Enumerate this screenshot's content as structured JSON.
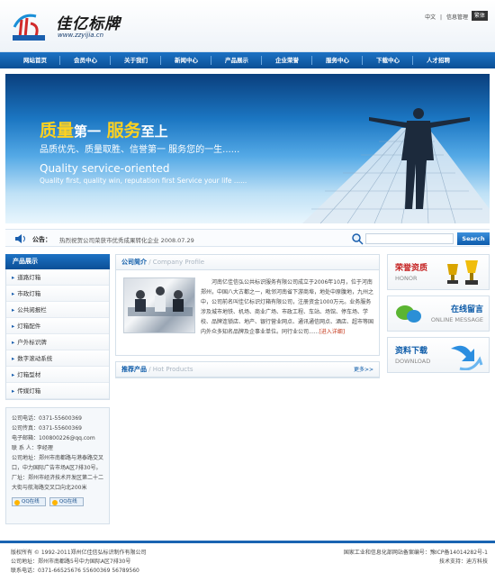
{
  "header": {
    "logo_title": "佳亿标牌",
    "logo_url": "www.zzyijia.cn",
    "top_links": [
      "中文",
      "|",
      "信息管理"
    ],
    "flag_label": "繁体"
  },
  "nav": {
    "items": [
      "网站首页",
      "会员中心",
      "关于我们",
      "新闻中心",
      "产品展示",
      "企业荣誉",
      "服务中心",
      "下载中心",
      "人才招聘"
    ]
  },
  "banner": {
    "title_part1": "质量",
    "title_part2": "第一",
    "title_part3": "服务",
    "title_part4": "至上",
    "slogan": "品质优先、质量取胜、信誉第一 服务您的一生......",
    "en_title": "Quality service-oriented",
    "en_sub": "Quality first, quality win, reputation first Service your life ......"
  },
  "notice": {
    "label": "公告：",
    "text": "热烈祝贺公司荣获市优秀成果转化企业 2008.07.29",
    "search_button": "Search"
  },
  "products_sidebar": {
    "title": "产品展示",
    "items": [
      "道路灯箱",
      "市政灯箱",
      "公共阅报栏",
      "灯箱配件",
      "户外标识牌",
      "数字滚动系统",
      "灯箱型材",
      "传媒灯箱"
    ]
  },
  "contact": {
    "lines": [
      "公司电话：0371-55600369",
      "公司传真：0371-55600369",
      "电子邮箱：100800226@qq.com",
      "联 系 人：李经理",
      "公司地址：郑州市南都路与港泰路交叉口，中力国际广告市场A区7排30号。",
      "厂址：郑州市经济技术开发区第二十二大街与航海路交叉口向北200米"
    ],
    "qq_labels": [
      "QQ在线",
      "QQ在线"
    ]
  },
  "intro": {
    "title_cn": "公司简介",
    "title_en": " / Company Profile",
    "text": "河南亿佳信弘公共标识服务有限公司成立于2006年10月，位于河南郑州，中国八大古都之一，毗邻河南省下游商埠，地处中原腹地，九州之中，公司前名叫佳亿标识灯箱有限公司，注册资金1000万元。业务服务涉及城市地铁、机场、商业广场、市政工程、车站、场馆、停车场、学校、品牌连锁店、地产、银行营业网点、通讯通信网点、酒店、超市等国内外众多知名品牌及企事业单位。同行业公司......",
    "more": "[进入详细]"
  },
  "hot": {
    "title_cn": "推荐产品",
    "title_en": " / Hot Products",
    "more": "更多>>"
  },
  "side": {
    "honor_cn": "荣誉资质",
    "honor_en": "HONOR",
    "msg_cn": "在线留言",
    "msg_en": "ONLINE MESSAGE",
    "dl_cn": "资料下载",
    "dl_en": "DOWNLOAD"
  },
  "footer": {
    "left": [
      "版权所有 © 1992-2011郑州亿佳信弘标识制作有限公司",
      "公司地址：郑州市南都路5号中力国际A区7排30号",
      "联系电话：0371-66525676  55600369  56789560"
    ],
    "right": [
      "国家工业和信息化部网站备案编号：豫ICP备14014282号-1",
      "技术支持：迪方科技"
    ]
  },
  "colors": {
    "nav_blue": "#0b4f96",
    "accent_yellow": "#ffd21f",
    "more_red": "#c4381b"
  }
}
